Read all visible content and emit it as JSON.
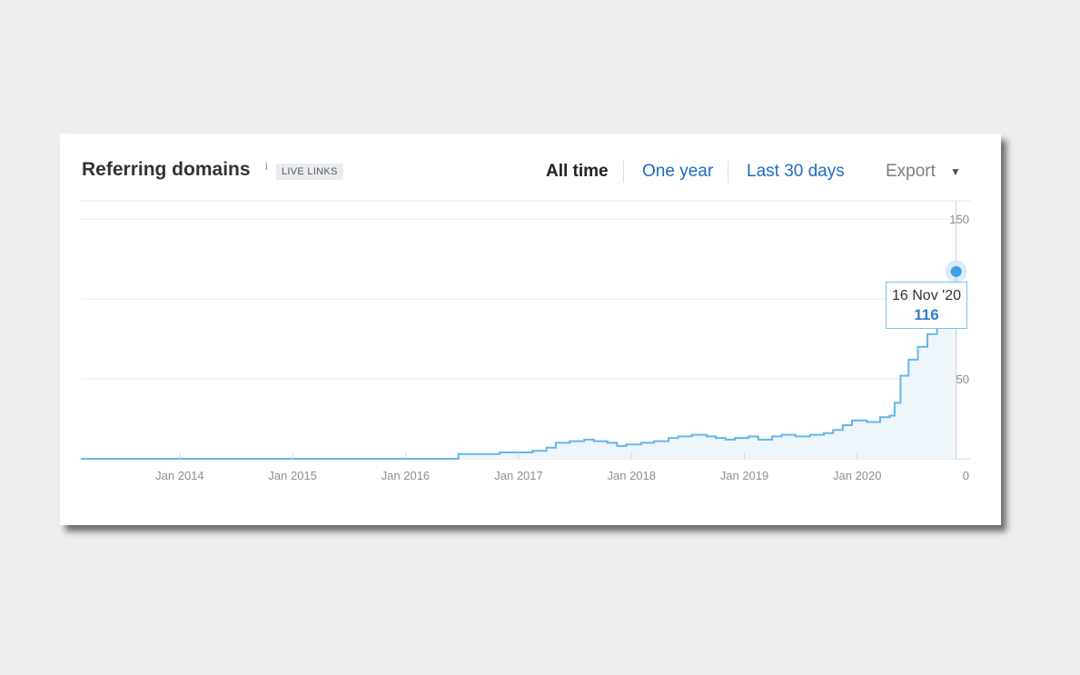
{
  "widget": {
    "title": "Referring domains",
    "info_icon": "i",
    "badge": "LIVE LINKS",
    "ranges": [
      "All time",
      "One year",
      "Last 30 days"
    ],
    "active_range": "All time",
    "export_label": "Export",
    "export_caret": "▼"
  },
  "tooltip": {
    "date": "16 Nov '20",
    "value": "116"
  },
  "colors": {
    "line": "#64b7e6",
    "area": "#eef5fb",
    "marker": "#3f9fe0",
    "link": "#1f6bc4"
  },
  "chart_data": {
    "type": "area",
    "x_tick_labels": [
      "Jan 2014",
      "Jan 2015",
      "Jan 2016",
      "Jan 2017",
      "Jan 2018",
      "Jan 2019",
      "Jan 2020"
    ],
    "y_tick_labels": [
      "150",
      "50",
      "0"
    ],
    "ylim": [
      0,
      150
    ],
    "xlim": [
      "2013-02-15",
      "2020-12-31"
    ],
    "grid": true,
    "highlight": {
      "x": "2020-11-16",
      "y": 116
    },
    "series": [
      {
        "points": [
          [
            "2013-02-15",
            0
          ],
          [
            "2016-06-01",
            0
          ],
          [
            "2016-06-20",
            3
          ],
          [
            "2016-10-01",
            3
          ],
          [
            "2016-11-01",
            4
          ],
          [
            "2017-02-15",
            5
          ],
          [
            "2017-04-01",
            7
          ],
          [
            "2017-05-01",
            10
          ],
          [
            "2017-06-15",
            11
          ],
          [
            "2017-08-01",
            12
          ],
          [
            "2017-09-01",
            11
          ],
          [
            "2017-10-15",
            10
          ],
          [
            "2017-11-15",
            8
          ],
          [
            "2017-12-15",
            9
          ],
          [
            "2018-02-01",
            10
          ],
          [
            "2018-03-15",
            11
          ],
          [
            "2018-05-01",
            13
          ],
          [
            "2018-06-01",
            14
          ],
          [
            "2018-07-15",
            15
          ],
          [
            "2018-09-01",
            14
          ],
          [
            "2018-10-01",
            13
          ],
          [
            "2018-11-01",
            12
          ],
          [
            "2018-12-01",
            13
          ],
          [
            "2019-01-15",
            14
          ],
          [
            "2019-02-15",
            12
          ],
          [
            "2019-04-01",
            14
          ],
          [
            "2019-05-01",
            15
          ],
          [
            "2019-06-15",
            14
          ],
          [
            "2019-08-01",
            15
          ],
          [
            "2019-09-15",
            16
          ],
          [
            "2019-10-15",
            18
          ],
          [
            "2019-11-15",
            21
          ],
          [
            "2019-12-15",
            24
          ],
          [
            "2020-02-01",
            23
          ],
          [
            "2020-03-15",
            26
          ],
          [
            "2020-04-15",
            27
          ],
          [
            "2020-05-01",
            35
          ],
          [
            "2020-05-20",
            52
          ],
          [
            "2020-06-15",
            62
          ],
          [
            "2020-07-15",
            70
          ],
          [
            "2020-08-15",
            78
          ],
          [
            "2020-09-15",
            92
          ],
          [
            "2020-10-15",
            108
          ],
          [
            "2020-11-16",
            116
          ]
        ]
      }
    ]
  }
}
